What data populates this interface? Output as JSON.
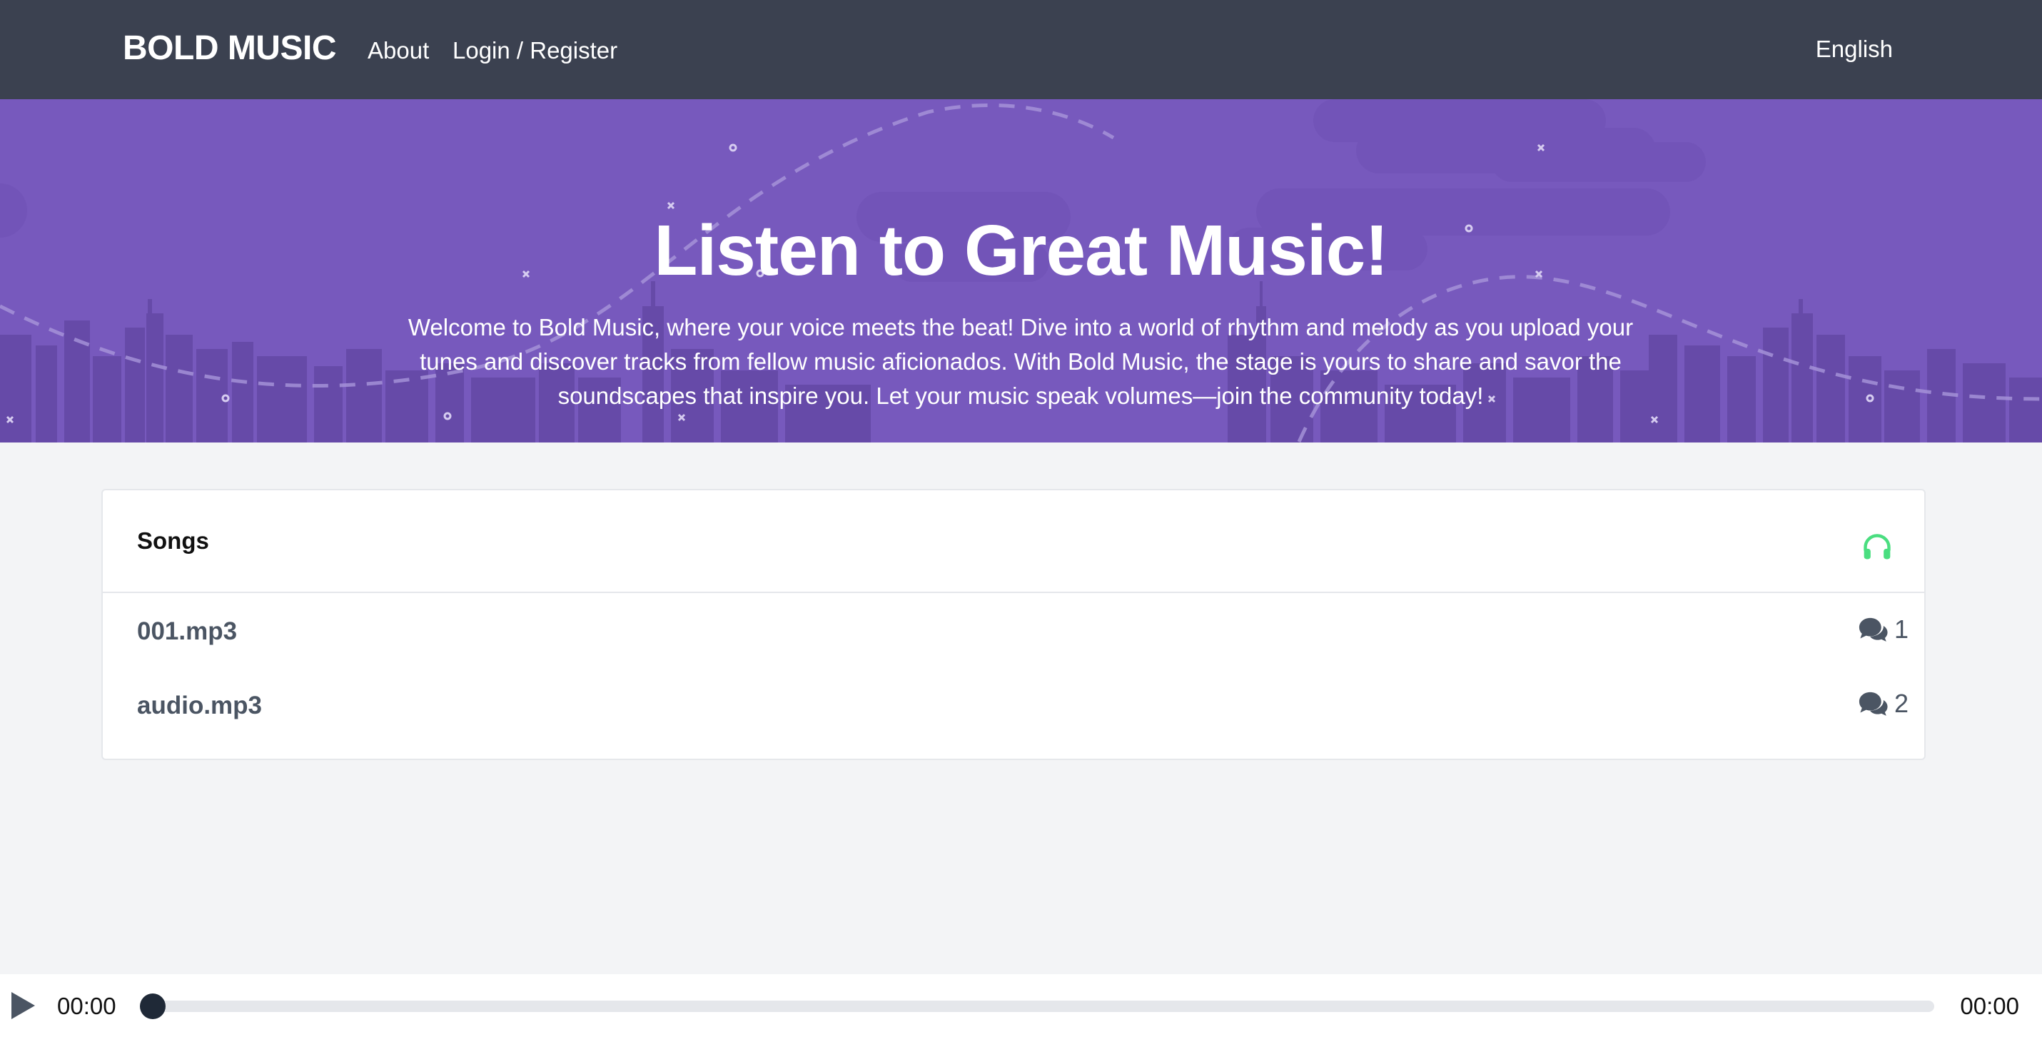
{
  "header": {
    "brand": "BOLD MUSIC",
    "nav": {
      "about": "About",
      "login_register": "Login / Register"
    },
    "language": "English"
  },
  "hero": {
    "title": "Listen to Great Music!",
    "text": "Welcome to Bold Music, where your voice meets the beat! Dive into a world of rhythm and melody as you upload your tunes and discover tracks from fellow music aficionados. With Bold Music, the stage is yours to share and savor the soundscapes that inspire you. Let your music speak volumes—join the community today!"
  },
  "songs": {
    "title": "Songs",
    "header_icon": "headphones-icon",
    "items": [
      {
        "name": "001.mp3",
        "comments": "1",
        "icon": "comments-icon"
      },
      {
        "name": "audio.mp3",
        "comments": "2",
        "icon": "comments-icon"
      }
    ]
  },
  "player": {
    "current_time": "00:00",
    "total_time": "00:00",
    "progress": 0,
    "play_icon": "play-icon"
  },
  "colors": {
    "header_bg": "#3b4150",
    "hero_bg": "#7759bd",
    "accent_green": "#4ade80",
    "text_muted": "#4b5563",
    "page_bg": "#f3f4f6"
  }
}
